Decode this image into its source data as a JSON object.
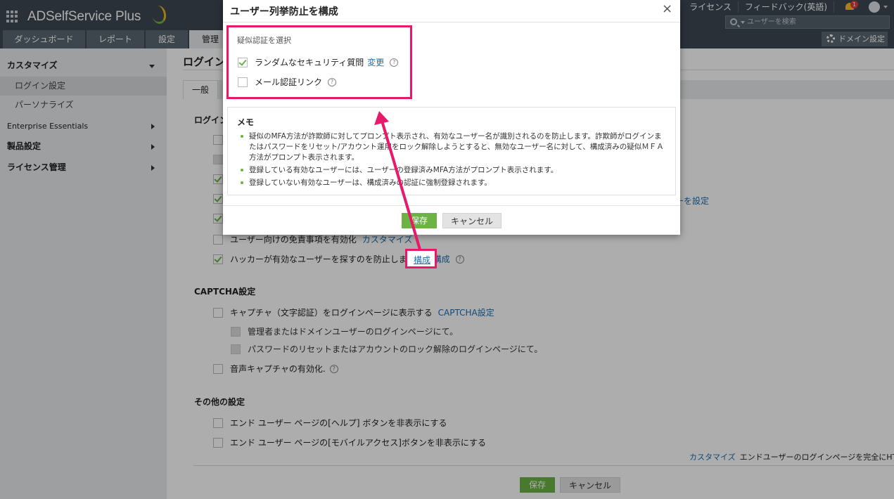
{
  "header": {
    "app_name": "ADSelfService Plus",
    "top_links": [
      "ライセンス",
      "フィードバック(英語)"
    ],
    "notification_count": "1",
    "search_placeholder": "ユーザーを検索",
    "tabs": [
      "ダッシュボード",
      "レポート",
      "設定",
      "管理"
    ],
    "active_tab": "管理",
    "domain_settings": "ドメイン設定"
  },
  "sidebar": {
    "items": [
      {
        "label": "カスタマイズ"
      },
      {
        "label": "ログイン設定"
      },
      {
        "label": "パーソナライズ"
      },
      {
        "label": "Enterprise Essentials"
      },
      {
        "label": "製品設定"
      },
      {
        "label": "ライセンス管理"
      }
    ]
  },
  "main": {
    "page_title": "ログイン",
    "subtab": "一般",
    "section_login": "ログイン",
    "partial_link": "ーを設定",
    "disclaimer_label": "ユーザー向けの免責事項を有効化",
    "disclaimer_link": "カスタマイズ",
    "hacker_label": "ハッカーが有効なユーザーを探すのを防止します。",
    "hacker_link": "構成",
    "captcha_title": "CAPTCHA設定",
    "captcha_label": "キャプチャ（文字認証）をログインページに表示する",
    "captcha_link": "CAPTCHA設定",
    "captcha_admin": "管理者またはドメインユーザーのログインページにて。",
    "captcha_reset": "パスワードのリセットまたはアカウントのロック解除のログインページにて。",
    "audio_captcha": "音声キャプチャの有効化.",
    "other_title": "その他の設定",
    "hide_help": "エンド ユーザー ページの[ヘルプ] ボタンを非表示にする",
    "hide_mobile": "エンド ユーザー ページの[モバイルアクセス]ボタンを非表示にする",
    "customize_link": "カスタマイズ",
    "customize_text": "エンドユーザーのログインページを完全にHT",
    "save": "保存",
    "cancel": "キャンセル"
  },
  "modal": {
    "title": "ユーザー列挙防止を構成",
    "close": "×",
    "mfa_heading": "疑似認証を選択",
    "opt_security_questions": "ランダムなセキュリティ質問",
    "opt_change_link": "変更",
    "opt_email_link": "メール認証リンク",
    "memo_title": "メモ",
    "memo_items": [
      "疑似のMFA方法が詐欺師に対してプロンプト表示され、有効なユーザー名が識別されるのを防止します。詐欺師がログインまたはパスワードをリセット/アカウント運用をロック解除しようとすると、無効なユーザー名に対して、構成済みの疑似ＭＦＡ方法がプロンプト表示されます。",
      "登録している有効なユーザーには、ユーザーの登録済みMFA方法がプロンプト表示されます。",
      "登録していない有効なユーザーは、構成済みの認証に強制登録されます。"
    ],
    "save": "保存",
    "cancel": "キャンセル"
  },
  "colors": {
    "topbar": "#3d4852",
    "accent_green": "#6ab344",
    "link_blue": "#1a6eb0",
    "highlight_pink": "#e8196a"
  }
}
